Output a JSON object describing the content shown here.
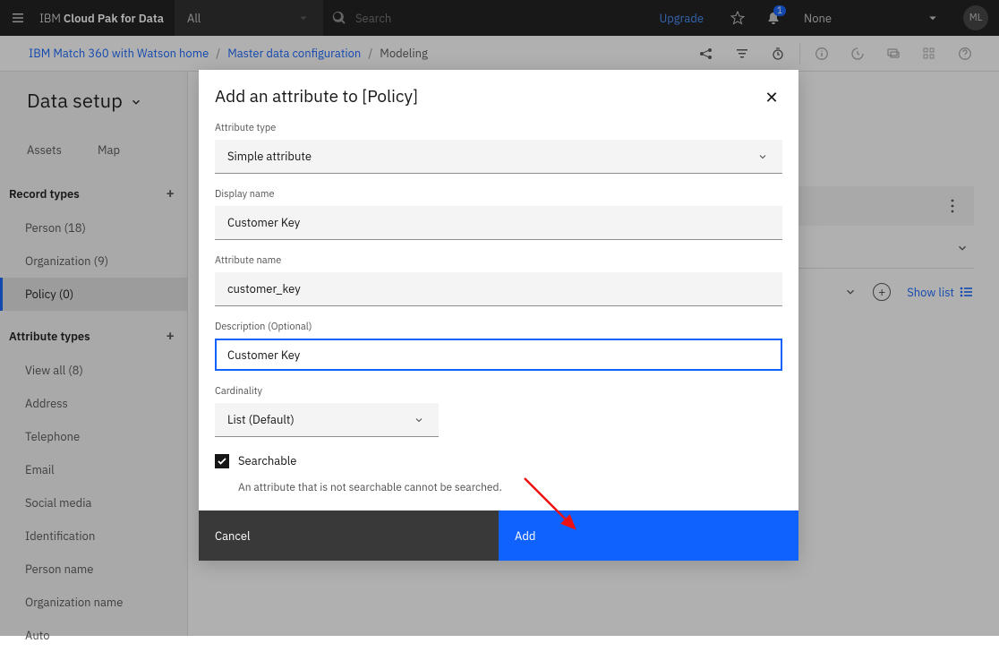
{
  "header": {
    "brand_prefix": "IBM ",
    "brand_bold": "Cloud Pak for Data",
    "all": "All",
    "search_placeholder": "Search",
    "upgrade": "Upgrade",
    "notif_count": "1",
    "none": "None",
    "avatar": "ML"
  },
  "breadcrumb": {
    "a": "IBM Match 360 with Watson home",
    "b": "Master data configuration",
    "c": "Modeling"
  },
  "page": {
    "title": "Data setup",
    "tabs": {
      "assets": "Assets",
      "map": "Map"
    }
  },
  "sidebar": {
    "record_types_head": "Record types",
    "record_types": [
      {
        "label": "Person (18)"
      },
      {
        "label": "Organization (9)"
      },
      {
        "label": "Policy (0)"
      }
    ],
    "attr_types_head": "Attribute types",
    "attr_types": [
      {
        "label": "View all (8)"
      },
      {
        "label": "Address"
      },
      {
        "label": "Telephone"
      },
      {
        "label": "Email"
      },
      {
        "label": "Social media"
      },
      {
        "label": "Identification"
      },
      {
        "label": "Person name"
      },
      {
        "label": "Organization name"
      },
      {
        "label": "Auto"
      }
    ]
  },
  "right": {
    "show_list": "Show list"
  },
  "modal": {
    "title": "Add an attribute to [Policy]",
    "attr_type_label": "Attribute type",
    "attr_type_value": "Simple attribute",
    "display_name_label": "Display name",
    "display_name_value": "Customer Key",
    "attr_name_label": "Attribute name",
    "attr_name_value": "customer_key",
    "desc_label": "Description (Optional)",
    "desc_value": "Customer Key",
    "cardinality_label": "Cardinality",
    "cardinality_value": "List (Default)",
    "searchable_label": "Searchable",
    "searchable_hint": "An attribute that is not searchable cannot be searched.",
    "cancel": "Cancel",
    "add": "Add"
  }
}
